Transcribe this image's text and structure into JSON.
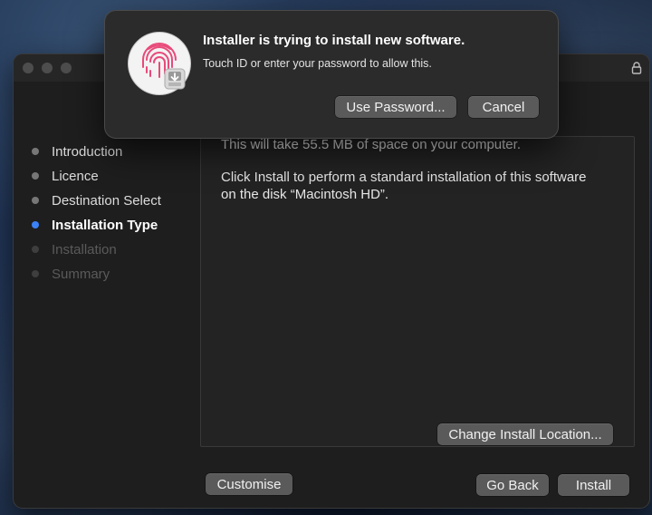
{
  "auth_dialog": {
    "title": "Installer is trying to install new software.",
    "message": "Touch ID or enter your password to allow this.",
    "use_password_label": "Use Password...",
    "cancel_label": "Cancel",
    "icon": "touch-id-fingerprint-icon"
  },
  "installer": {
    "steps": [
      {
        "label": "Introduction",
        "state": "done"
      },
      {
        "label": "Licence",
        "state": "done"
      },
      {
        "label": "Destination Select",
        "state": "done"
      },
      {
        "label": "Installation Type",
        "state": "current"
      },
      {
        "label": "Installation",
        "state": "pending"
      },
      {
        "label": "Summary",
        "state": "pending"
      }
    ],
    "space_text": "This will take 55.5 MB of space on your computer.",
    "install_text_line1": "Click Install to perform a standard installation of this software",
    "install_text_line2": "on the disk “Macintosh HD”.",
    "change_location_label": "Change Install Location...",
    "customise_label": "Customise",
    "go_back_label": "Go Back",
    "install_label": "Install"
  },
  "colors": {
    "accent": "#3b82f6",
    "window_bg": "#1e1e1e",
    "button_bg": "#5a5a5a",
    "fingerprint": "#e84a7a"
  }
}
